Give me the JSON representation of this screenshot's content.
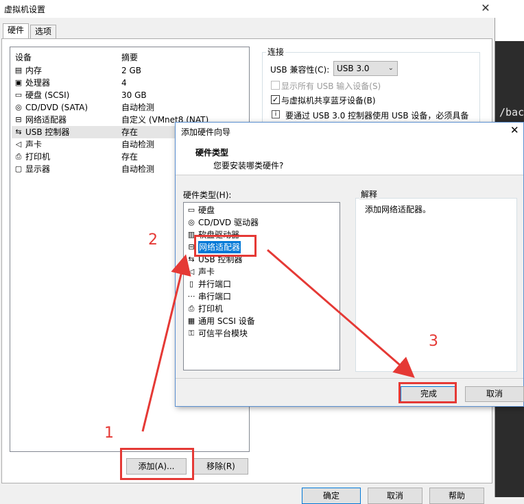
{
  "background": {
    "terminal_text": "/bac"
  },
  "main_dialog": {
    "title": "虚拟机设置",
    "tabs": [
      {
        "label": "硬件",
        "active": true
      },
      {
        "label": "选项",
        "active": false
      }
    ],
    "device_list": {
      "headers": {
        "device": "设备",
        "summary": "摘要"
      },
      "rows": [
        {
          "icon": "memory-icon",
          "name": "内存",
          "summary": "2 GB"
        },
        {
          "icon": "cpu-icon",
          "name": "处理器",
          "summary": "4"
        },
        {
          "icon": "disk-icon",
          "name": "硬盘 (SCSI)",
          "summary": "30 GB"
        },
        {
          "icon": "cd-icon",
          "name": "CD/DVD (SATA)",
          "summary": "自动检测"
        },
        {
          "icon": "network-icon",
          "name": "网络适配器",
          "summary": "自定义 (VMnet8 (NAT)"
        },
        {
          "icon": "usb-icon",
          "name": "USB 控制器",
          "summary": "存在"
        },
        {
          "icon": "sound-icon",
          "name": "声卡",
          "summary": "自动检测"
        },
        {
          "icon": "printer-icon",
          "name": "打印机",
          "summary": "存在"
        },
        {
          "icon": "display-icon",
          "name": "显示器",
          "summary": "自动检测"
        }
      ]
    },
    "add_button": "添加(A)...",
    "remove_button": "移除(R)",
    "connection": {
      "legend": "连接",
      "usb_compat_label": "USB 兼容性(C):",
      "usb_compat_value": "USB 3.0",
      "show_all_usb": "显示所有 USB 输入设备(S)",
      "share_bluetooth": "与虚拟机共享蓝牙设备(B)",
      "info_text": "要通过 USB 3.0 控制器使用 USB 设备，必须具备"
    },
    "bottom_buttons": [
      "确定",
      "取消",
      "帮助"
    ]
  },
  "wizard": {
    "title": "添加硬件向导",
    "header_title": "硬件类型",
    "header_subtitle": "您要安装哪类硬件?",
    "list_label": "硬件类型(H):",
    "items": [
      {
        "icon": "disk-icon",
        "label": "硬盘"
      },
      {
        "icon": "cd-icon",
        "label": "CD/DVD 驱动器"
      },
      {
        "icon": "floppy-icon",
        "label": "软盘驱动器"
      },
      {
        "icon": "network-icon",
        "label": "网络适配器"
      },
      {
        "icon": "usb-icon",
        "label": "USB 控制器"
      },
      {
        "icon": "sound-icon",
        "label": "声卡"
      },
      {
        "icon": "parallel-port-icon",
        "label": "并行端口"
      },
      {
        "icon": "serial-port-icon",
        "label": "串行端口"
      },
      {
        "icon": "printer-icon",
        "label": "打印机"
      },
      {
        "icon": "scsi-icon",
        "label": "通用 SCSI 设备"
      },
      {
        "icon": "tpm-icon",
        "label": "可信平台模块"
      }
    ],
    "explain_title": "解释",
    "explain_text": "添加网络适配器。",
    "finish_button": "完成",
    "cancel_button": "取消"
  },
  "annotations": {
    "step1": "1",
    "step2": "2",
    "step3": "3",
    "accent_color": "#e53935"
  }
}
